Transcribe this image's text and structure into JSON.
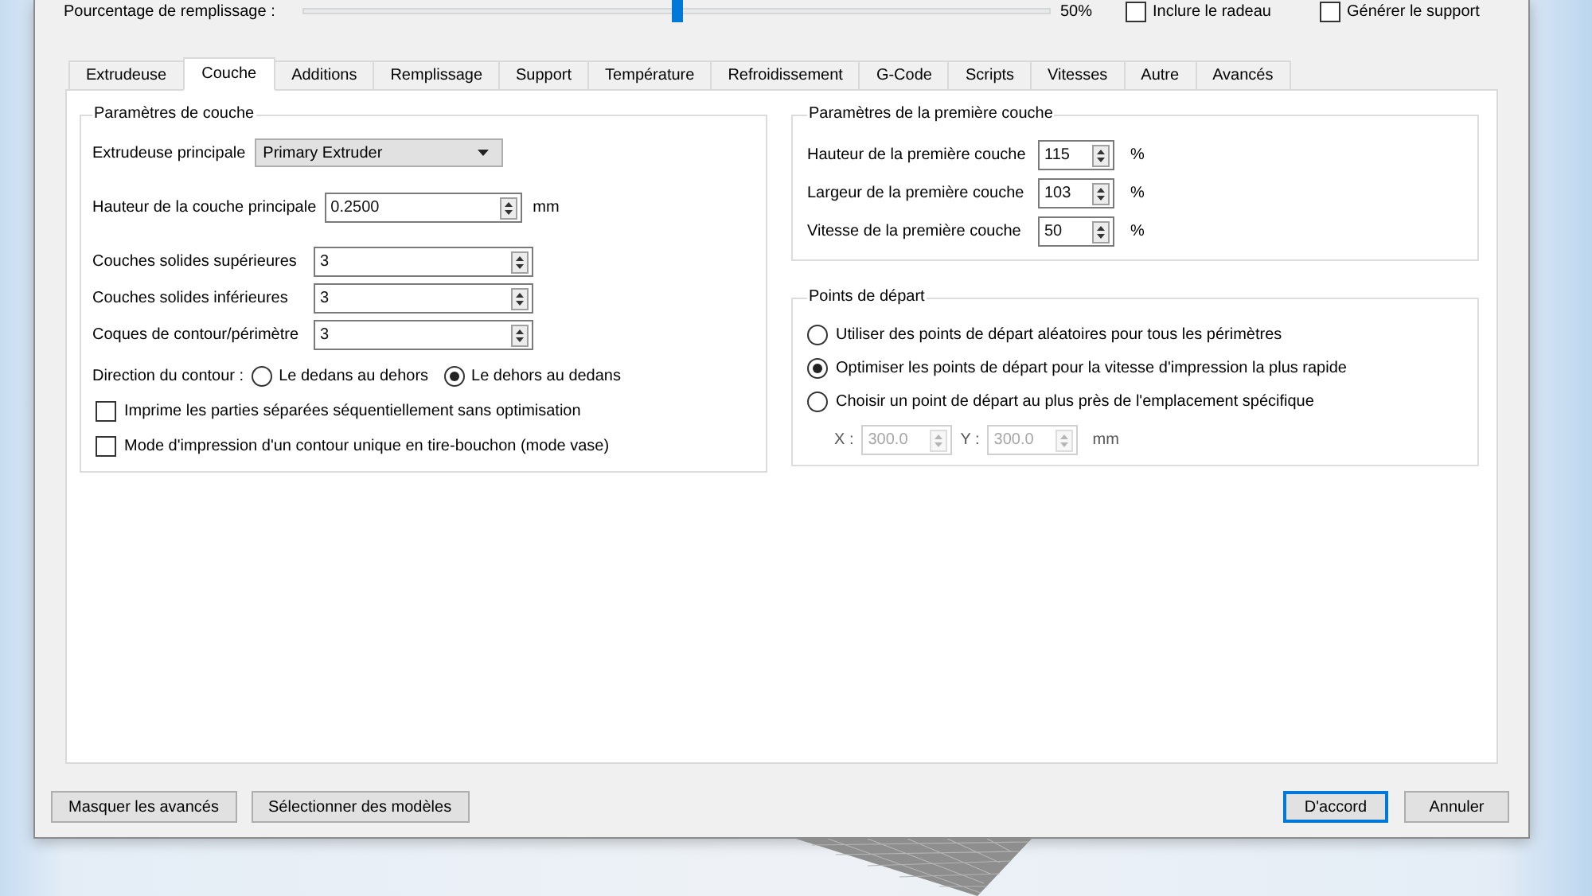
{
  "fill_bar": {
    "label": "Pourcentage de remplissage :",
    "level": 0.5,
    "reading": "50%",
    "options": [
      {
        "label": "Inclure le radeau",
        "checked": false
      },
      {
        "label": "Générer le support",
        "checked": false
      }
    ]
  },
  "tabs": [
    {
      "label": "Extrudeuse",
      "selected": false
    },
    {
      "label": "Couche",
      "selected": true
    },
    {
      "label": "Additions",
      "selected": false
    },
    {
      "label": "Remplissage",
      "selected": false
    },
    {
      "label": "Support",
      "selected": false
    },
    {
      "label": "Température",
      "selected": false
    },
    {
      "label": "Refroidissement",
      "selected": false
    },
    {
      "label": "G-Code",
      "selected": false
    },
    {
      "label": "Scripts",
      "selected": false
    },
    {
      "label": "Vitesses",
      "selected": false
    },
    {
      "label": "Autre",
      "selected": false
    },
    {
      "label": "Avancés",
      "selected": false
    }
  ],
  "layer_group": {
    "title": "Paramètres de couche",
    "extruder": {
      "label": "Extrudeuse principale",
      "value": "Primary Extruder"
    },
    "layer_height": {
      "label": "Hauteur de la couche principale",
      "value": "0.2500",
      "unit": "mm"
    },
    "shells": [
      {
        "label": "Couches solides supérieures",
        "value": "3"
      },
      {
        "label": "Couches solides inférieures",
        "value": "3"
      },
      {
        "label": "Coques de contour/périmètre",
        "value": "3"
      }
    ],
    "direction": {
      "label": "Direction du contour :",
      "options": [
        {
          "label": "Le dedans au dehors",
          "selected": false
        },
        {
          "label": "Le dehors au dedans",
          "selected": true
        }
      ]
    },
    "options": [
      {
        "label": "Imprime les parties séparées séquentiellement sans optimisation",
        "checked": false
      },
      {
        "label": "Mode d'impression d'un contour unique en tire-bouchon (mode vase)",
        "checked": false
      }
    ]
  },
  "first_layer_group": {
    "title": "Paramètres de la première couche",
    "fields": [
      {
        "label": "Hauteur de la première couche",
        "value": "115",
        "unit": "%"
      },
      {
        "label": "Largeur de la première couche",
        "value": "103",
        "unit": "%"
      },
      {
        "label": "Vitesse de la première couche",
        "value": "50",
        "unit": "%"
      }
    ]
  },
  "start_point_group": {
    "title": "Points de départ",
    "options": [
      {
        "label": "Utiliser des points de départ aléatoires pour tous les périmètres",
        "selected": false
      },
      {
        "label": "Optimiser les points de départ pour la vitesse d'impression la plus rapide",
        "selected": true
      },
      {
        "label": "Choisir un point de départ au plus près de l'emplacement spécifique",
        "selected": false
      }
    ],
    "position": {
      "disabled": true,
      "fields": [
        {
          "label": "X :",
          "value": "300.0"
        },
        {
          "label": "Y :",
          "value": "300.0"
        }
      ],
      "unit": "mm"
    }
  },
  "left_buttons": [
    {
      "label": "Masquer les avancés",
      "default": false
    },
    {
      "label": "Sélectionner des modèles",
      "default": false
    }
  ],
  "right_buttons": [
    {
      "label": "D'accord",
      "default": true
    },
    {
      "label": "Annuler",
      "default": false
    }
  ]
}
